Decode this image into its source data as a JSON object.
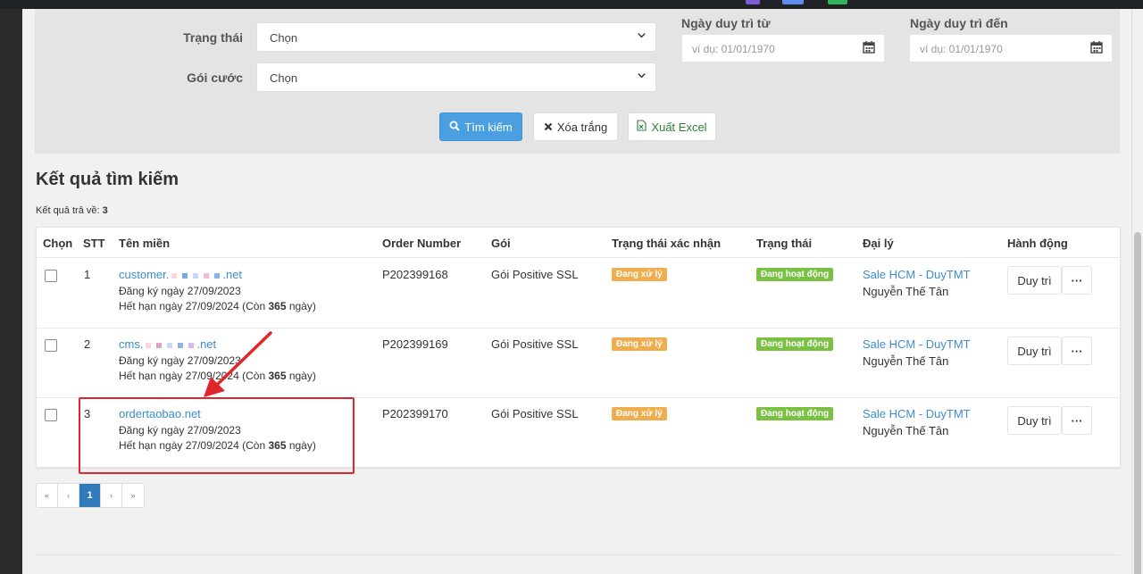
{
  "filters": {
    "status_label": "Trạng thái",
    "status_value": "Chọn",
    "package_label": "Gói cước",
    "package_value": "Chọn",
    "date_from_label": "Ngày duy trì từ",
    "date_from_placeholder": "ví dụ: 01/01/1970",
    "date_to_label": "Ngày duy trì đến",
    "date_to_placeholder": "ví dụ: 01/01/1970",
    "search_button": "Tìm kiếm",
    "clear_button": "Xóa trắng",
    "export_button": "Xuất Excel"
  },
  "results": {
    "title": "Kết quả tìm kiếm",
    "count_label": "Kết quả trả về:",
    "count_value": "3"
  },
  "table": {
    "headers": [
      "Chọn",
      "STT",
      "Tên miền",
      "Order Number",
      "Gói",
      "Trạng thái xác nhận",
      "Trạng thái",
      "Đại lý",
      "Hành động"
    ],
    "rows": [
      {
        "stt": "1",
        "domain_prefix": "customer.",
        "domain_suffix": ".net",
        "registered": "Đăng ký ngày 27/09/2023",
        "expiry_prefix": "Hết hạn ngày 27/09/2024 (Còn ",
        "days": "365",
        "expiry_suffix": " ngày)",
        "order": "P202399168",
        "package": "Gói Positive SSL",
        "confirm_status": "Đang xử lý",
        "status": "Đang hoạt động",
        "agent": "Sale HCM - DuyTMT",
        "agent_name": "Nguyễn Thế Tân",
        "action": "Duy trì",
        "more": "···"
      },
      {
        "stt": "2",
        "domain_prefix": "cms.",
        "domain_suffix": ".net",
        "registered": "Đăng ký ngày 27/09/2023",
        "expiry_prefix": "Hết hạn ngày 27/09/2024 (Còn ",
        "days": "365",
        "expiry_suffix": " ngày)",
        "order": "P202399169",
        "package": "Gói Positive SSL",
        "confirm_status": "Đang xử lý",
        "status": "Đang hoạt động",
        "agent": "Sale HCM - DuyTMT",
        "agent_name": "Nguyễn Thế Tân",
        "action": "Duy trì",
        "more": "···"
      },
      {
        "stt": "3",
        "domain_prefix": "ordertaobao.net",
        "domain_suffix": "",
        "registered": "Đăng ký ngày 27/09/2023",
        "expiry_prefix": "Hết hạn ngày 27/09/2024 (Còn ",
        "days": "365",
        "expiry_suffix": " ngày)",
        "order": "P202399170",
        "package": "Gói Positive SSL",
        "confirm_status": "Đang xử lý",
        "status": "Đang hoạt động",
        "agent": "Sale HCM - DuyTMT",
        "agent_name": "Nguyễn Thế Tân",
        "action": "Duy trì",
        "more": "···"
      }
    ]
  },
  "pagination": {
    "first": "«",
    "prev": "‹",
    "current": "1",
    "next": "›",
    "last": "»"
  },
  "colors": {
    "primary": "#4a9fe0",
    "link": "#3c8dd0",
    "badge_processing": "#f0ad4e",
    "badge_active": "#7ac143",
    "annotation": "#e0262b"
  }
}
